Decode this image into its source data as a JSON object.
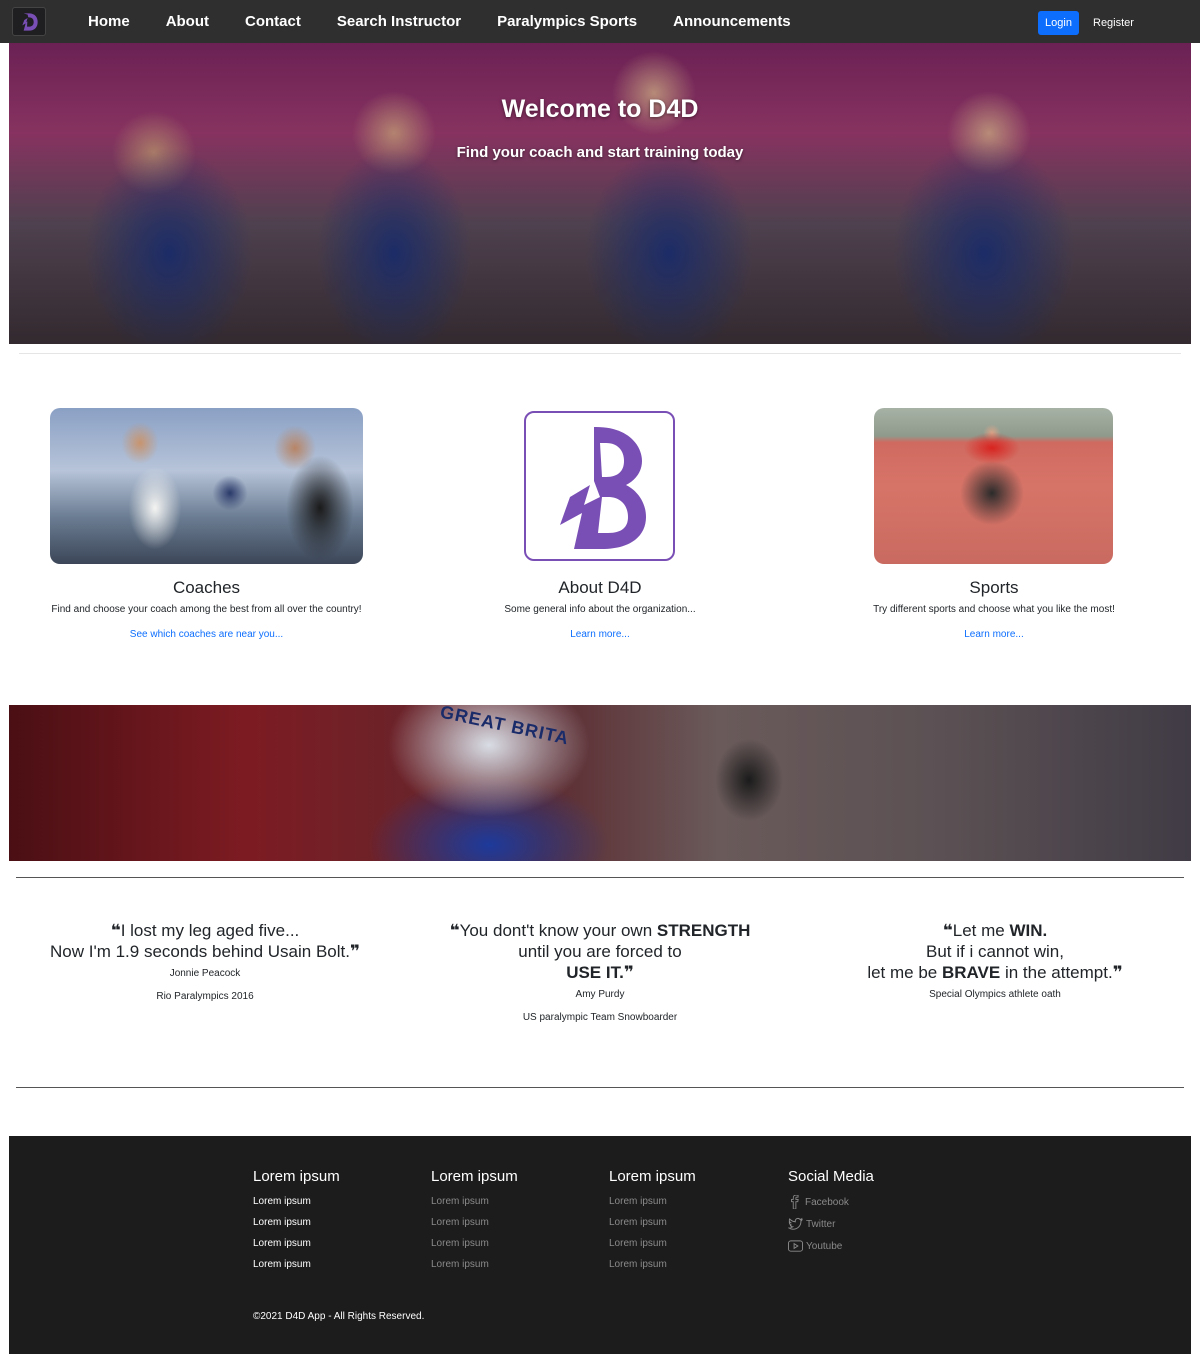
{
  "nav": {
    "items": [
      "Home",
      "About",
      "Contact",
      "Search Instructor",
      "Paralympics Sports",
      "Announcements"
    ],
    "login_label": "Login",
    "register_label": "Register"
  },
  "hero": {
    "title": "Welcome to D4D",
    "subtitle": "Find your coach and start training today"
  },
  "cards": [
    {
      "title": "Coaches",
      "text": "Find and choose your coach among the best from all over the country!",
      "link": "See which coaches are near you..."
    },
    {
      "title": "About D4D",
      "text": "Some general info about the organization...",
      "link": "Learn more..."
    },
    {
      "title": "Sports",
      "text": "Try different sports and choose what you like the most!",
      "link": "Learn more..."
    }
  ],
  "banner": {
    "text": "GREAT BRITA"
  },
  "quotes": [
    {
      "l1": "I lost my leg aged five...",
      "l2": "Now I'm 1.9 seconds behind Usain Bolt.",
      "author": "Jonnie Peacock",
      "detail": "Rio Paralympics 2016"
    },
    {
      "l1a": "You dont't know your own ",
      "l1b": "STRENGTH",
      "l2": "until you are forced to",
      "l3": "USE IT.",
      "author": "Amy Purdy",
      "detail": "US paralympic Team Snowboarder"
    },
    {
      "l1a": "Let me ",
      "l1b": "WIN.",
      "l2": "But if i cannot win,",
      "l3a": "let me be ",
      "l3b": "BRAVE",
      "l3c": " in the attempt.",
      "author": "Special Olympics athlete oath"
    }
  ],
  "footer": {
    "columns": [
      {
        "heading": "Lorem ipsum",
        "items": [
          "Lorem ipsum",
          "Lorem ipsum",
          "Lorem ipsum",
          "Lorem ipsum"
        ]
      },
      {
        "heading": "Lorem ipsum",
        "items": [
          "Lorem ipsum",
          "Lorem ipsum",
          "Lorem ipsum",
          "Lorem ipsum"
        ]
      },
      {
        "heading": "Lorem ipsum",
        "items": [
          "Lorem ipsum",
          "Lorem ipsum",
          "Lorem ipsum",
          "Lorem ipsum"
        ]
      }
    ],
    "social": {
      "heading": "Social Media",
      "items": [
        "Facebook",
        "Twitter",
        "Youtube"
      ]
    },
    "copyright": "©2021 D4D App - All Rights Reserved."
  },
  "colors": {
    "brand_purple": "#7a4fb5",
    "primary_blue": "#0d6efd",
    "nav_bg": "#2f2f30",
    "footer_bg": "#1c1c1c"
  },
  "icons": [
    "d4d-logo-icon",
    "facebook-icon",
    "twitter-icon",
    "youtube-icon",
    "quote-open-icon",
    "quote-close-icon"
  ]
}
